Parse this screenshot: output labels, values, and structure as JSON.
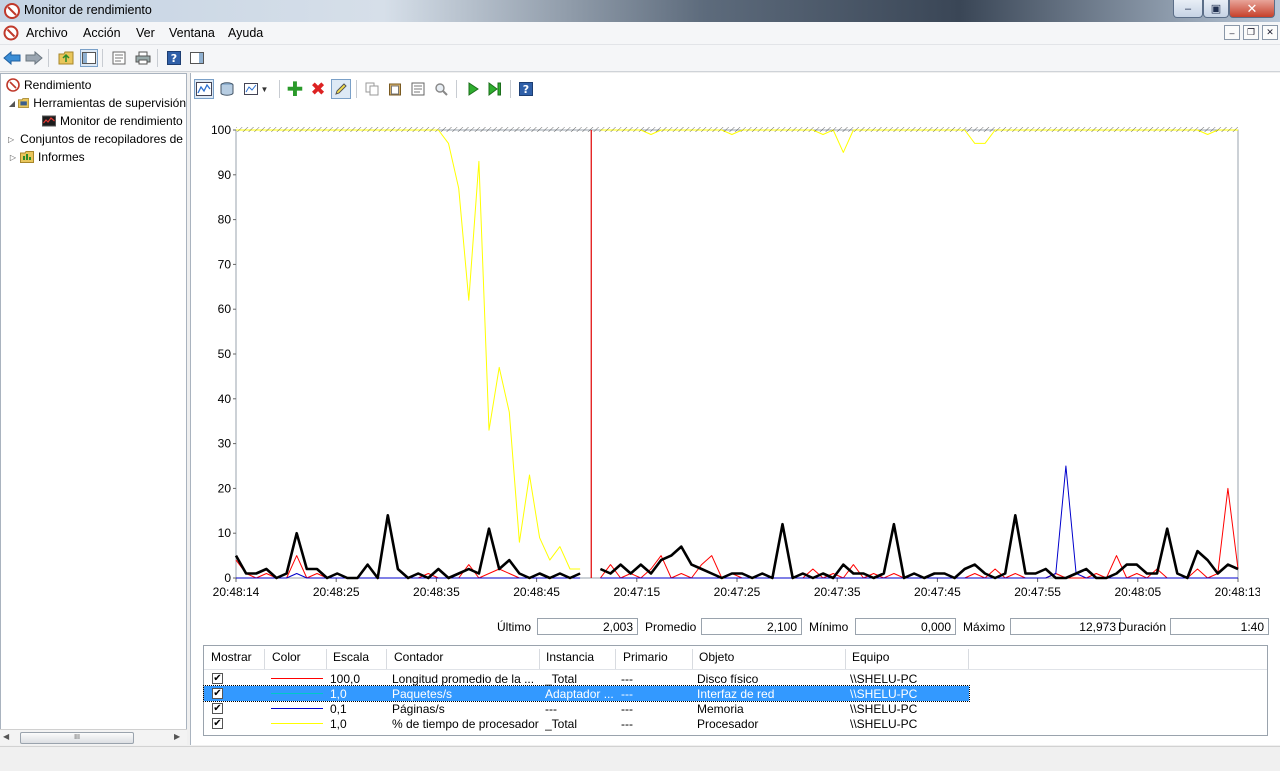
{
  "window": {
    "title": "Monitor de rendimiento",
    "min": "–",
    "max": "▣",
    "close": "✕"
  },
  "menu": [
    "Archivo",
    "Acción",
    "Ver",
    "Ventana",
    "Ayuda"
  ],
  "tree": {
    "items": [
      {
        "label": "Rendimiento",
        "icon": "performance-icon"
      },
      {
        "label": "Herramientas de supervisión",
        "icon": "folder-monitor-icon"
      },
      {
        "label": "Monitor de rendimiento",
        "icon": "chart-monitor-icon"
      },
      {
        "label": "Conjuntos de recopiladores de datos",
        "icon": "folder-collectors-icon"
      },
      {
        "label": "Informes",
        "icon": "folder-reports-icon"
      }
    ],
    "scroll_thumb": "III"
  },
  "chart_data": {
    "type": "line",
    "ylim": [
      0,
      100
    ],
    "yticks": [
      "0",
      "10",
      "20",
      "30",
      "40",
      "50",
      "60",
      "70",
      "80",
      "90",
      "100"
    ],
    "xticks": [
      "20:48:14",
      "20:48:25",
      "20:48:35",
      "20:48:45",
      "20:47:15",
      "20:47:25",
      "20:47:35",
      "20:47:45",
      "20:47:55",
      "20:48:05",
      "20:48:13"
    ],
    "samples": 100,
    "current_position": 35,
    "series": [
      {
        "name": "% de tiempo de procesador",
        "color": "#ffff00",
        "values": [
          100,
          100,
          100,
          100,
          100,
          100,
          100,
          100,
          100,
          100,
          100,
          100,
          100,
          100,
          100,
          100,
          100,
          100,
          100,
          100,
          100,
          97,
          87,
          62,
          93,
          33,
          47,
          37,
          8,
          23,
          9,
          4,
          7,
          2,
          2,
          2,
          100,
          100,
          100,
          100,
          100,
          99,
          100,
          100,
          100,
          100,
          100,
          100,
          100,
          99,
          100,
          100,
          100,
          100,
          100,
          100,
          100,
          100,
          99,
          100,
          95,
          100,
          100,
          100,
          100,
          100,
          100,
          100,
          100,
          100,
          100,
          100,
          100,
          97,
          97,
          100,
          100,
          100,
          100,
          100,
          100,
          100,
          100,
          100,
          100,
          100,
          100,
          100,
          100,
          100,
          100,
          100,
          100,
          100,
          100,
          100,
          99,
          100,
          100,
          100
        ]
      },
      {
        "name": "Longitud promedio de la cola de disco",
        "color": "#ff0000",
        "values": [
          4,
          1,
          0,
          1,
          0,
          0,
          5,
          0,
          1,
          0,
          0,
          0,
          0,
          0,
          0,
          0,
          0,
          0,
          0,
          1,
          0,
          0,
          0,
          3,
          0,
          1,
          2,
          1,
          0,
          0,
          1,
          0,
          1,
          0,
          1,
          0,
          0,
          3,
          0,
          1,
          0,
          2,
          5,
          0,
          1,
          0,
          3,
          5,
          0,
          1,
          0,
          0,
          0,
          0,
          0,
          0,
          0,
          2,
          0,
          1,
          0,
          3,
          0,
          1,
          0,
          1,
          0,
          0,
          0,
          0,
          0,
          0,
          0,
          1,
          0,
          2,
          0,
          1,
          0,
          0,
          0,
          1,
          0,
          0,
          0,
          1,
          0,
          5,
          0,
          1,
          0,
          2,
          0,
          0,
          0,
          2,
          0,
          1,
          20,
          2,
          0,
          0,
          1,
          0,
          4,
          0
        ]
      },
      {
        "name": "Paquetes/s",
        "color": "#0000cc",
        "values": [
          0,
          0,
          0,
          0,
          0,
          0,
          1,
          0,
          0,
          0,
          0,
          0,
          0,
          0,
          0,
          0,
          0,
          0,
          0,
          0,
          0,
          0,
          0,
          0,
          0,
          0,
          0,
          0,
          0,
          0,
          0,
          0,
          0,
          0,
          0,
          0,
          0,
          0,
          0,
          0,
          0,
          0,
          0,
          0,
          0,
          0,
          0,
          0,
          0,
          0,
          0,
          0,
          0,
          0,
          0,
          0,
          0,
          0,
          0,
          0,
          0,
          0,
          0,
          0,
          0,
          0,
          0,
          0,
          0,
          0,
          0,
          0,
          0,
          0,
          0,
          0,
          0,
          0,
          0,
          0,
          0,
          1,
          25,
          1,
          0,
          0,
          0,
          0,
          0,
          0,
          0,
          0,
          0,
          0,
          0,
          0,
          0,
          0,
          0,
          0
        ]
      },
      {
        "name": "Páginas/s",
        "color": "#000000",
        "values": [
          5,
          1,
          1,
          2,
          0,
          1,
          10,
          2,
          2,
          0,
          1,
          0,
          0,
          3,
          0,
          14,
          2,
          0,
          1,
          0,
          2,
          0,
          1,
          2,
          1,
          11,
          2,
          4,
          1,
          0,
          1,
          0,
          1,
          0,
          1,
          2,
          2,
          1,
          3,
          1,
          3,
          1,
          4,
          5,
          7,
          3,
          2,
          1,
          0,
          1,
          1,
          0,
          1,
          0,
          12,
          0,
          1,
          0,
          1,
          0,
          3,
          1,
          1,
          0,
          1,
          12,
          0,
          1,
          0,
          1,
          1,
          0,
          2,
          3,
          1,
          0,
          1,
          14,
          1,
          1,
          2,
          0,
          0,
          1,
          2,
          0,
          0,
          1,
          3,
          3,
          1,
          1,
          11,
          1,
          0,
          6,
          4,
          1,
          3,
          2,
          1,
          11,
          2,
          0
        ]
      }
    ]
  },
  "stats": {
    "last_label": "Último",
    "last": "2,003",
    "avg_label": "Promedio",
    "avg": "2,100",
    "min_label": "Mínimo",
    "min": "0,000",
    "max_label": "Máximo",
    "max": "12,973",
    "dur_label": "Duración",
    "dur": "1:40"
  },
  "table": {
    "headers": [
      "Mostrar",
      "Color",
      "Escala",
      "Contador",
      "Instancia",
      "Primario",
      "Objeto",
      "Equipo"
    ],
    "rows": [
      {
        "check": "✔",
        "color": "#ff0000",
        "scale": "100,0",
        "counter": "Longitud promedio de la ...",
        "instance": "_Total",
        "parent": "---",
        "object": "Disco físico",
        "computer": "\\\\SHELU-PC"
      },
      {
        "check": "✔",
        "color": "#00c8c8",
        "scale": "1,0",
        "counter": "Paquetes/s",
        "instance": "Adaptador ...",
        "parent": "---",
        "object": "Interfaz de red",
        "computer": "\\\\SHELU-PC"
      },
      {
        "check": "✔",
        "color": "#0000cc",
        "scale": "0,1",
        "counter": "Páginas/s",
        "instance": "---",
        "parent": "---",
        "object": "Memoria",
        "computer": "\\\\SHELU-PC"
      },
      {
        "check": "✔",
        "color": "#ffff00",
        "scale": "1,0",
        "counter": "% de tiempo de procesador",
        "instance": "_Total",
        "parent": "---",
        "object": "Procesador",
        "computer": "\\\\SHELU-PC"
      }
    ],
    "selected_row": 1
  }
}
